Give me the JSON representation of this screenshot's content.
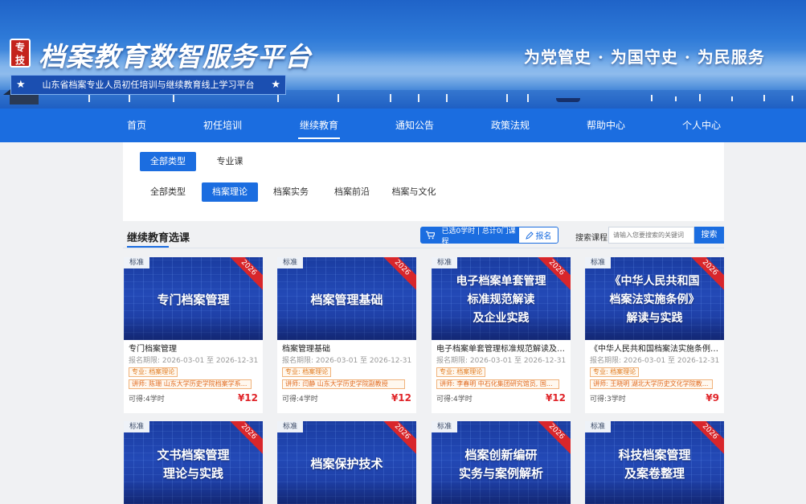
{
  "header": {
    "seal_text": "专技",
    "site_title": "档案教育数智服务平台",
    "subtitle": "山东省档案专业人员初任培训与继续教育线上学习平台",
    "slogan": "为党管史 · 为国守史 · 为民服务",
    "star_glyph": "★"
  },
  "nav": {
    "items": [
      {
        "label": "首页"
      },
      {
        "label": "初任培训"
      },
      {
        "label": "继续教育",
        "active": true
      },
      {
        "label": "通知公告"
      },
      {
        "label": "政策法规"
      },
      {
        "label": "帮助中心"
      },
      {
        "label": "个人中心"
      }
    ]
  },
  "filters": {
    "type_row": [
      "全部类型",
      "专业课"
    ],
    "type_selected": "全部类型",
    "category_row": [
      "全部类型",
      "档案理论",
      "档案实务",
      "档案前沿",
      "档案与文化"
    ],
    "category_selected": "档案理论"
  },
  "section": {
    "title": "继续教育选课",
    "cart_status": "已选0学时 | 总计0门课程",
    "enroll_label": "报名",
    "search_label": "搜索课程",
    "search_placeholder": "请输入您要搜索的关键词",
    "search_button": "搜索"
  },
  "cards": [
    {
      "badge": "标准",
      "year": "2026",
      "cover": "专门档案管理",
      "name": "专门档案管理",
      "date": "报名期限: 2026-03-01 至 2026-12-31",
      "tag": "专业: 档案理论",
      "lecturer": "讲师: 陈珊  山东大学历史学院档案学系...",
      "hours": "可得:4学时",
      "price": "¥12"
    },
    {
      "badge": "标准",
      "year": "2026",
      "cover": "档案管理基础",
      "name": "档案管理基础",
      "date": "报名期限: 2026-03-01 至 2026-12-31",
      "tag": "专业: 档案理论",
      "lecturer": "讲师: 闫静  山东大学历史学院副教授",
      "hours": "可得:4学时",
      "price": "¥12"
    },
    {
      "badge": "标准",
      "year": "2026",
      "cover": "电子档案单套管理\n标准规范解读\n及企业实践",
      "name": "电子档案单套管理标准规范解读及企...",
      "date": "报名期限: 2026-03-01 至 2026-12-31",
      "tag": "专业: 档案理论",
      "lecturer": "讲师: 李春明  中石化集团研究馆员, 国...",
      "hours": "可得:4学时",
      "price": "¥12"
    },
    {
      "badge": "标准",
      "year": "2026",
      "cover": "《中华人民共和国\n档案法实施条例》\n解读与实践",
      "name": "《中华人民共和国档案法实施条例》...",
      "date": "报名期限: 2026-03-01 至 2026-12-31",
      "tag": "专业: 档案理论",
      "lecturer": "讲师: 王晓明  湖北大学历史文化学院教...",
      "hours": "可得:3学时",
      "price": "¥9"
    },
    {
      "badge": "标准",
      "year": "2026",
      "cover": "文书档案管理\n理论与实践"
    },
    {
      "badge": "标准",
      "year": "2026",
      "cover": "档案保护技术"
    },
    {
      "badge": "标准",
      "year": "2026",
      "cover": "档案创新编研\n实务与案例解析"
    },
    {
      "badge": "标准",
      "year": "2026",
      "cover": "科技档案管理\n及案卷整理"
    }
  ]
}
